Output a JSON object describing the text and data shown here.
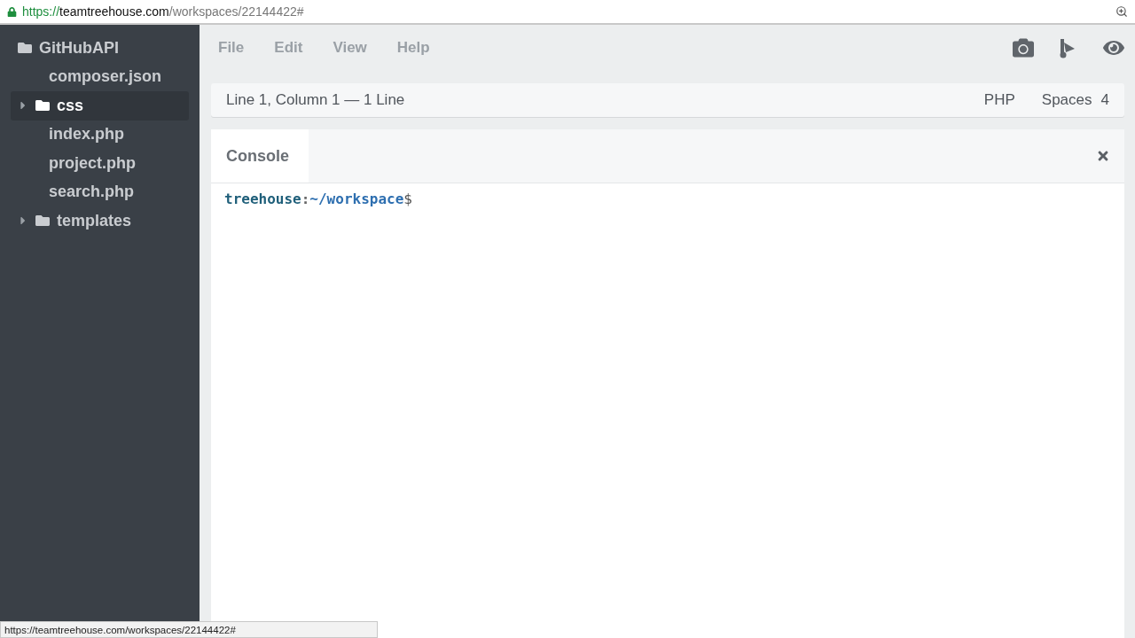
{
  "address_bar": {
    "scheme": "https://",
    "host": "teamtreehouse.com",
    "path": "/workspaces/22144422#"
  },
  "sidebar": {
    "tree": [
      {
        "kind": "folder",
        "name": "GitHubAPI",
        "selected": false,
        "children": [
          {
            "kind": "file",
            "name": "composer.json",
            "selected": false
          },
          {
            "kind": "folder",
            "name": "css",
            "expanded": false,
            "selected": true
          },
          {
            "kind": "file",
            "name": "index.php",
            "selected": false
          },
          {
            "kind": "file",
            "name": "project.php",
            "selected": false
          },
          {
            "kind": "file",
            "name": "search.php",
            "selected": false
          },
          {
            "kind": "folder",
            "name": "templates",
            "expanded": false,
            "selected": false
          }
        ]
      }
    ]
  },
  "menu": [
    "File",
    "Edit",
    "View",
    "Help"
  ],
  "status_bar": {
    "position": "Line 1, Column 1 — 1 Line",
    "language": "PHP",
    "indent_label": "Spaces",
    "indent_size": "4"
  },
  "console": {
    "tab": "Console",
    "prompt_user": "treehouse",
    "prompt_sep": ":",
    "prompt_path": "~/workspace",
    "prompt_symbol": "$"
  },
  "link_preview": "https://teamtreehouse.com/workspaces/22144422#"
}
